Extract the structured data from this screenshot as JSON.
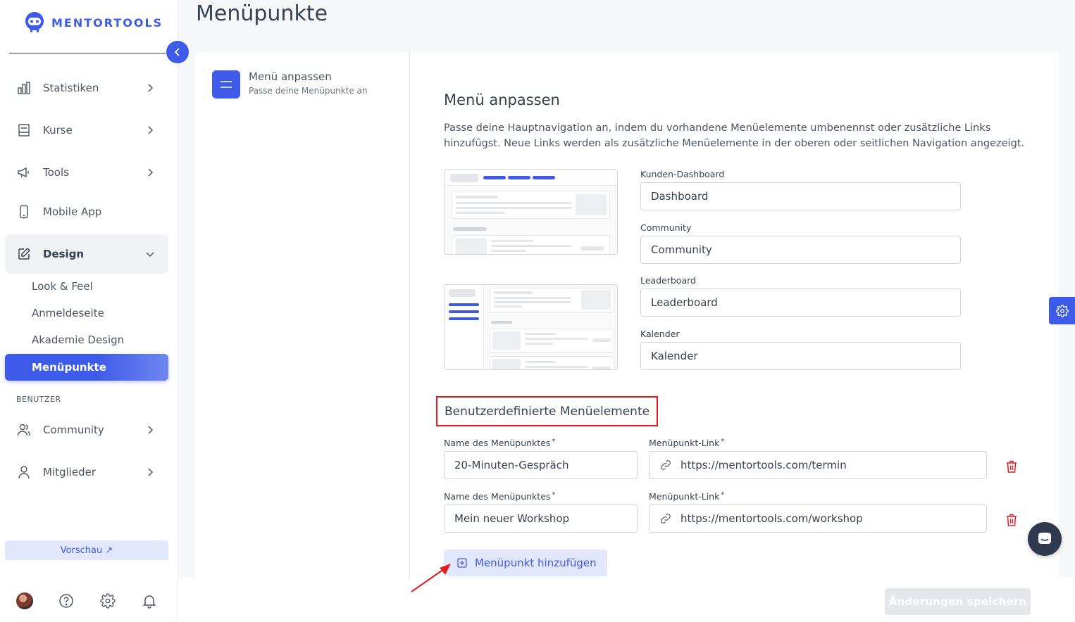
{
  "brand": {
    "name": "MENTORTOOLS",
    "accent": "#3d5ae8"
  },
  "sidebar": {
    "items": [
      {
        "label": "Statistiken",
        "icon": "bar-chart-icon"
      },
      {
        "label": "Kurse",
        "icon": "book-icon"
      },
      {
        "label": "Tools",
        "icon": "megaphone-icon"
      },
      {
        "label": "Mobile App",
        "icon": "phone-icon"
      },
      {
        "label": "Design",
        "icon": "edit-icon"
      }
    ],
    "design_sub": [
      "Look & Feel",
      "Anmeldeseite",
      "Akademie Design",
      "Menüpunkte"
    ],
    "section_label": "BENUTZER",
    "user_items": [
      {
        "label": "Community",
        "icon": "users-icon"
      },
      {
        "label": "Mitglieder",
        "icon": "user-icon"
      }
    ],
    "preview_label": "Vorschau ↗"
  },
  "page": {
    "title": "Menüpunkte"
  },
  "step": {
    "title": "Menü anpassen",
    "subtitle": "Passe deine Menüpunkte an"
  },
  "section": {
    "title": "Menü anpassen",
    "description": "Passe deine Hauptnavigation an, indem du vorhandene Menüelemente umbenennst oder zusätzliche Links hinzufügst. Neue Links werden als zusätzliche Menüelemente in der oberen oder seitlichen Navigation angezeigt."
  },
  "fields": [
    {
      "label": "Kunden-Dashboard",
      "value": "Dashboard"
    },
    {
      "label": "Community",
      "value": "Community"
    },
    {
      "label": "Leaderboard",
      "value": "Leaderboard"
    },
    {
      "label": "Kalender",
      "value": "Kalender"
    }
  ],
  "custom": {
    "title": "Benutzerdefinierte Menüelemente",
    "name_label": "Name des Menüpunktes",
    "link_label": "Menüpunkt-Link",
    "required_mark": "*",
    "rows": [
      {
        "name": "20-Minuten-Gespräch",
        "link": "https://mentortools.com/termin"
      },
      {
        "name": "Mein neuer Workshop",
        "link": "https://mentortools.com/workshop"
      }
    ],
    "add_label": "Menüpunkt hinzufügen"
  },
  "save_label": "Änderungen speichern"
}
